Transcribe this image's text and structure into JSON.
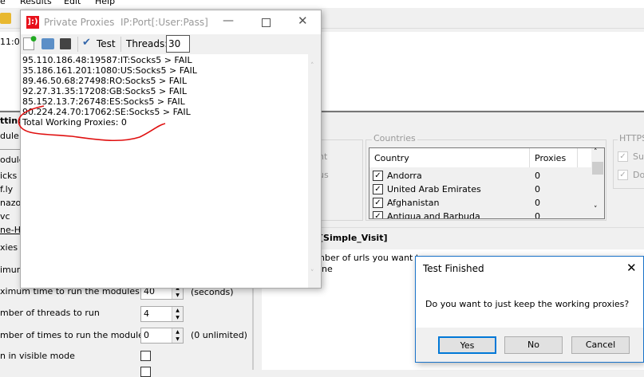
{
  "main_window": {
    "menu": [
      "e",
      "Results",
      "Edit",
      "Help"
    ],
    "time": "11:04",
    "left_panel": {
      "header": "ttings",
      "sub": "dule",
      "list_header": "odule",
      "modules": [
        "icks",
        "f.ly",
        "nazon",
        "vc",
        "ne-H"
      ],
      "proxies_label": "xies t",
      "min_label": "imum",
      "max_time_label": "ximum time to run the modules",
      "max_time_value": "40",
      "max_time_unit": "(seconds)",
      "threads_label": "mber of threads to run",
      "threads_value": "4",
      "times_label": "mber of times to run the modules",
      "times_value": "0",
      "times_unit": "(0 unlimited)",
      "visible_label": "n in visible mode"
    },
    "left_group": {
      "items": [
        "nt",
        "us"
      ]
    },
    "countries": {
      "legend": "Countries",
      "columns": [
        "Country",
        "Proxies"
      ],
      "rows": [
        {
          "name": "Andorra",
          "proxies": "0"
        },
        {
          "name": "United Arab Emirates",
          "proxies": "0"
        },
        {
          "name": "Afghanistan",
          "proxies": "0"
        },
        {
          "name": "Antigua and Barbuda",
          "proxies": "0"
        }
      ]
    },
    "https": {
      "legend": "HTTPS",
      "items": [
        "Su",
        "Do"
      ]
    },
    "module_section": {
      "title": "[Simple_Visit]",
      "lines": [
        "nber of urls you want to",
        "ine"
      ]
    }
  },
  "proxies_window": {
    "title": "Private Proxies",
    "subtitle": "IP:Port[:User:Pass]",
    "test_label": "Test",
    "threads_label": "Threads:",
    "threads_value": "30",
    "log": [
      "95.110.186.48:19587:IT:Socks5 > FAIL",
      "35.186.161.201:1080:US:Socks5 > FAIL",
      "89.46.50.68:27498:RO:Socks5 > FAIL",
      "92.27.31.35:17208:GB:Socks5 > FAIL",
      "85.152.13.7:26748:ES:Socks5 > FAIL",
      "90.224.24.70:17062:SE:Socks5 > FAIL",
      "Total Working Proxies: 0"
    ],
    "logo_text": "]:)"
  },
  "dialog": {
    "title": "Test Finished",
    "message": "Do you want to just keep the working proxies?",
    "yes": "Yes",
    "no": "No",
    "cancel": "Cancel"
  },
  "colors": {
    "annotation": "#e01010",
    "accent": "#0078d7",
    "logo": "#e8101a"
  }
}
